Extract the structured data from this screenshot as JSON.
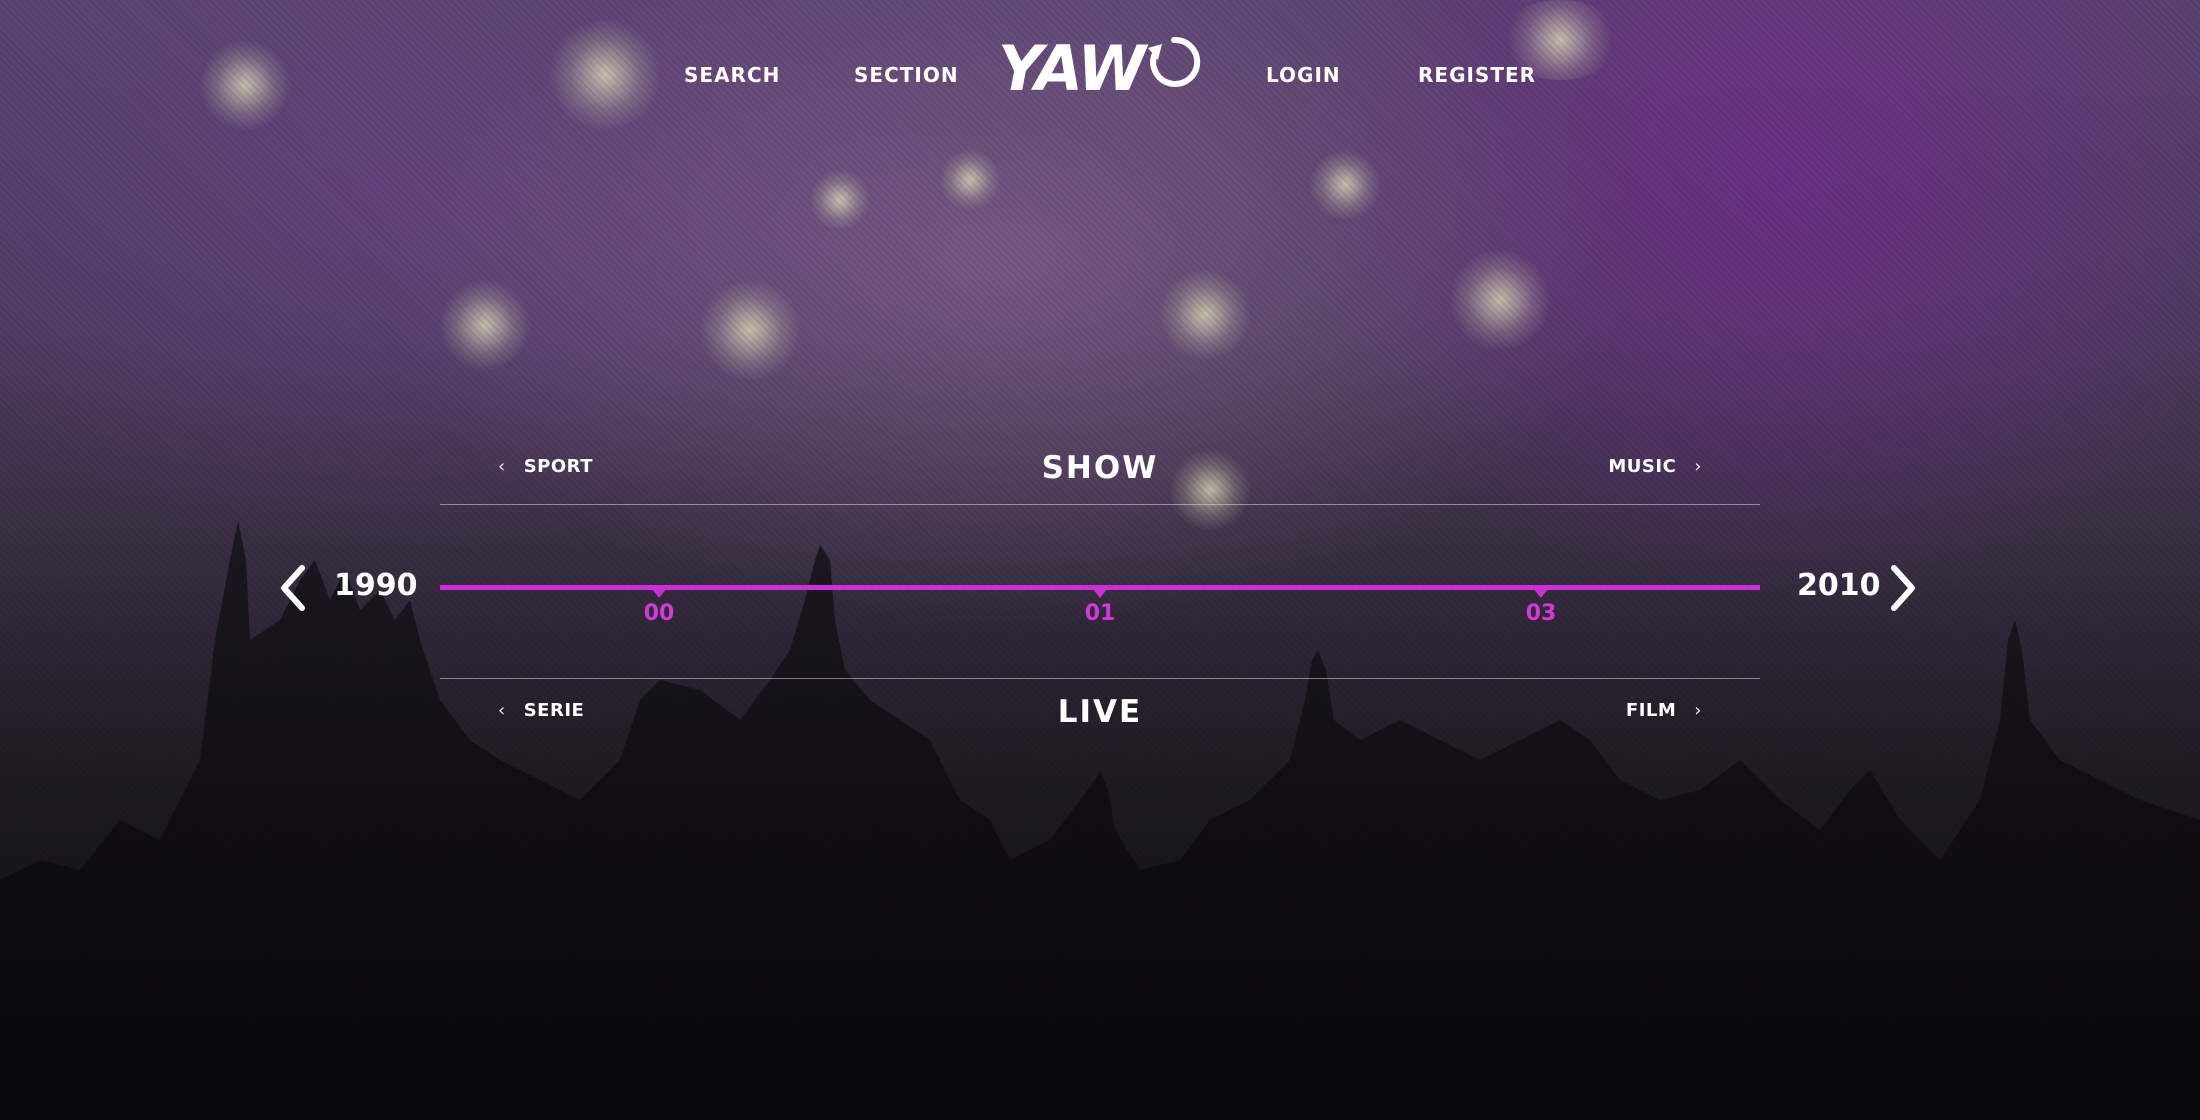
{
  "nav": {
    "left_links": [
      "SEARCH",
      "SECTION"
    ],
    "logo": "YAW",
    "right_links": [
      "LOGIN",
      "REGISTER"
    ]
  },
  "top_row": {
    "prev": "SPORT",
    "title": "SHOW",
    "next": "MUSIC"
  },
  "timeline": {
    "start_year": "1990",
    "end_year": "2010",
    "markers": [
      "00",
      "01",
      "03"
    ]
  },
  "bottom_row": {
    "prev": "SERIE",
    "title": "LIVE",
    "next": "FILM"
  },
  "colors": {
    "accent": "#cc2fd6",
    "text": "#ffffff",
    "background_top": "#5b4470",
    "background_bottom": "#0c0b10"
  },
  "icons": {
    "row_prev": "chevron-left-icon",
    "row_next": "chevron-right-icon",
    "timeline_prev": "arrow-left-icon",
    "timeline_next": "arrow-right-icon"
  }
}
